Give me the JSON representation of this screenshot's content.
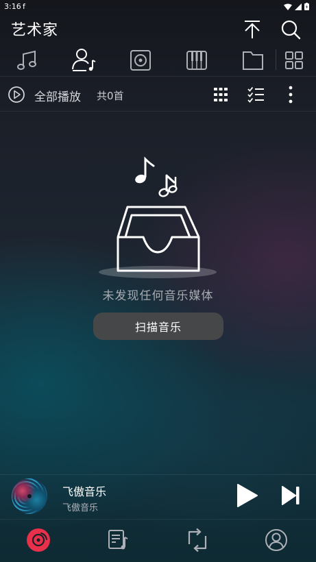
{
  "status_bar": {
    "time": "3:16",
    "app_icon": "f"
  },
  "header": {
    "title": "艺术家"
  },
  "toolbar": {
    "play_all_label": "全部播放",
    "count_label": "共0首"
  },
  "empty_state": {
    "message": "未发现任何音乐媒体",
    "scan_button_label": "扫描音乐"
  },
  "mini_player": {
    "title": "飞傲音乐",
    "artist": "飞傲音乐"
  },
  "icons": {
    "header": [
      "scroll-to-top-icon",
      "search-icon"
    ],
    "tabs": [
      "music-note-icon",
      "artist-icon",
      "album-icon",
      "piano-icon",
      "folder-icon",
      "grid-icon"
    ],
    "toolbar": [
      "play-circle-icon",
      "grid-view-icon",
      "multi-select-icon",
      "more-vert-icon"
    ],
    "player": [
      "play-icon",
      "skip-next-icon"
    ],
    "bottom_nav": [
      "vinyl-icon",
      "playlist-icon",
      "switch-icon",
      "profile-icon"
    ]
  },
  "colors": {
    "accent": "#e8304a",
    "scan_button_bg": "#464749",
    "muted_text": "#a7abb2"
  }
}
